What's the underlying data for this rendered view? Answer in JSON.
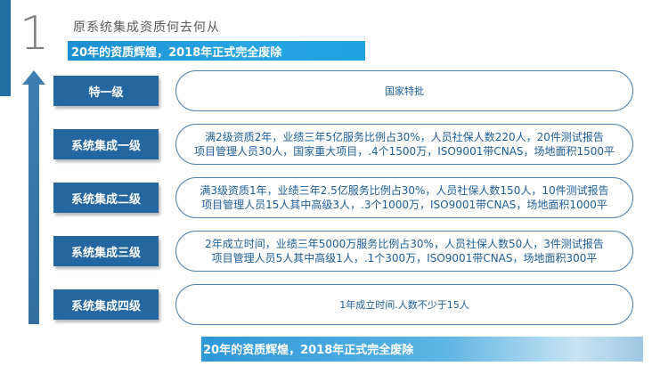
{
  "header": {
    "number": "1",
    "title": "原系统集成资质何去何从"
  },
  "top_banner": "20年的资质辉煌，2018年正式完全废除",
  "bottom_banner": "20年的资质辉煌，2018年正式完全废除",
  "levels": [
    {
      "label": "特一级",
      "lines": [
        "国家特批"
      ]
    },
    {
      "label": "系统集成一级",
      "lines": [
        "满2级资质2年，业绩三年5亿服务比例占30%，人员社保人数220人，20件测试报告",
        "项目管理人员30人，国家重大项目，.4个1500万，ISO9001带CNAS，场地面积1500平"
      ]
    },
    {
      "label": "系统集成二级",
      "lines": [
        "满3级资质1年，业绩三年2.5亿服务比例占30%，人员社保人数150人，10件测试报告",
        "项目管理人员15人其中高级3人，.3个1000万，ISO9001带CNAS，场地面积1000平"
      ]
    },
    {
      "label": "系统集成三级",
      "lines": [
        "2年成立时间，业绩三年5000万服务比例占30%，人员社保人数50人，3件测试报告",
        "项目管理人员5人其中高级1人，.1个300万，ISO9001带CNAS，场地面积300平"
      ]
    },
    {
      "label": "系统集成四级",
      "lines": [
        "1年成立时间.人数不少于15人"
      ]
    }
  ]
}
